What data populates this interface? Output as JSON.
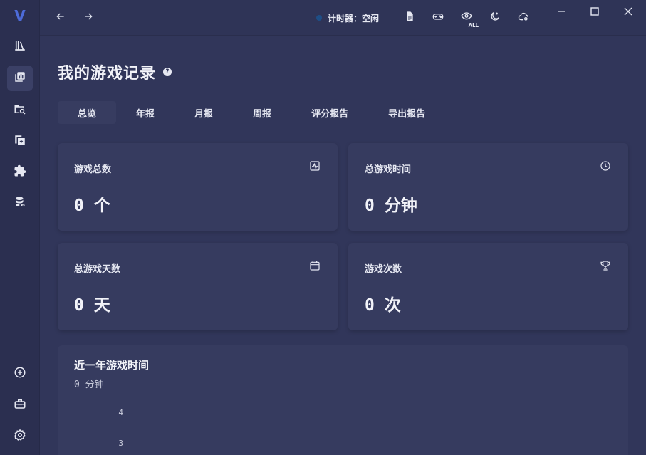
{
  "sidebar": {
    "logo": "V",
    "items": [
      {
        "icon": "library-icon"
      },
      {
        "icon": "records-icon",
        "active": true
      },
      {
        "icon": "folder-search-icon"
      },
      {
        "icon": "import-icon"
      },
      {
        "icon": "plugin-icon"
      },
      {
        "icon": "database-icon"
      },
      {
        "icon": "add-circle-icon"
      },
      {
        "icon": "toolbox-icon"
      },
      {
        "icon": "settings-icon"
      }
    ]
  },
  "topbar": {
    "timer_label": "计时器：空闲",
    "timer_color": "#1e4e86",
    "tools": [
      "document-icon",
      "gamepad-icon",
      "eye-all-icon",
      "night-mode-icon",
      "cloud-settings-icon"
    ],
    "eye_badge": "ALL"
  },
  "page": {
    "title": "我的游戏记录",
    "tabs": [
      "总览",
      "年报",
      "月报",
      "周报",
      "评分报告",
      "导出报告"
    ],
    "active_tab": 0
  },
  "cards": [
    {
      "label": "游戏总数",
      "value": "0 个",
      "icon": "activity-icon"
    },
    {
      "label": "总游戏时间",
      "value": "0 分钟",
      "icon": "clock-icon"
    },
    {
      "label": "总游戏天数",
      "value": "0 天",
      "icon": "calendar-icon"
    },
    {
      "label": "游戏次数",
      "value": "0 次",
      "icon": "trophy-icon"
    }
  ],
  "chart_data": {
    "type": "line",
    "title": "近一年游戏时间",
    "subtitle": "0 分钟",
    "y_ticks": [
      4,
      3
    ],
    "values": []
  },
  "colors": {
    "accent": "#4d6bd8",
    "background": "#31365a",
    "card": "#363b5f"
  }
}
